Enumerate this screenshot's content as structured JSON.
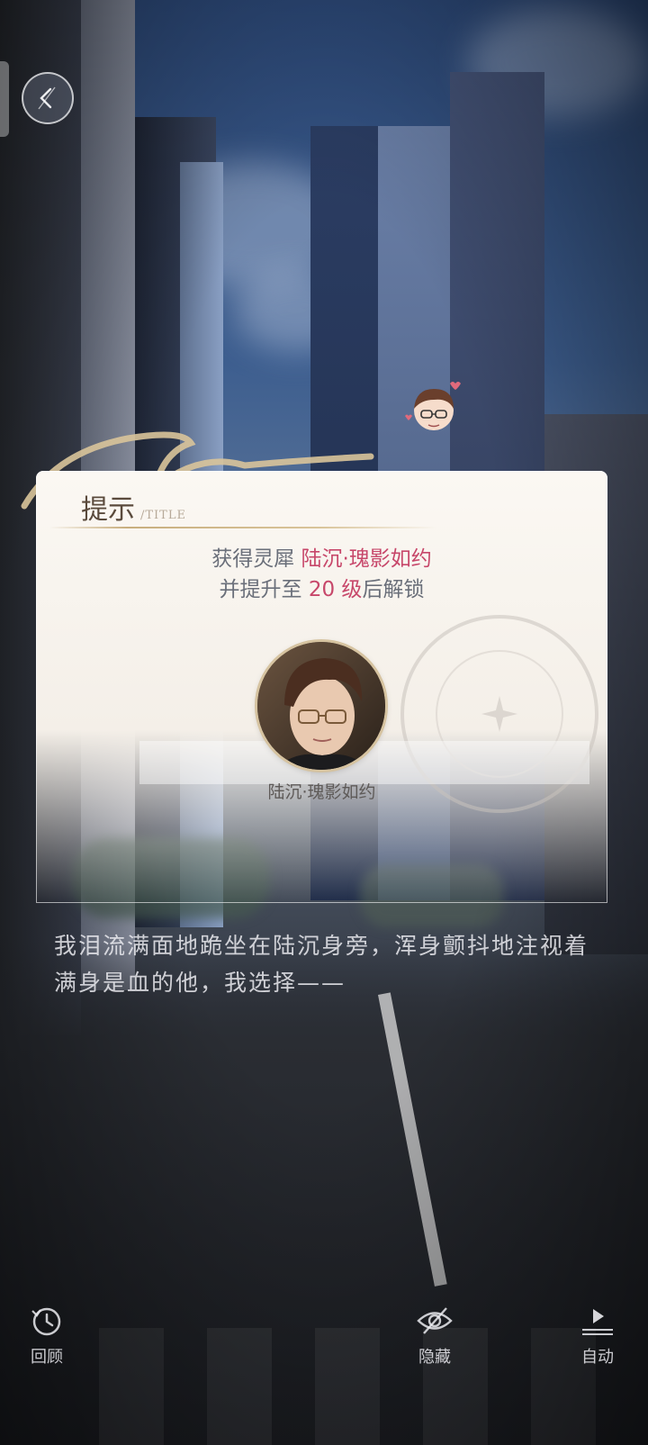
{
  "hint_card": {
    "title": "提示",
    "title_en": "/TITLE",
    "line1_prefix": "获得灵犀 ",
    "line1_highlight": "陆沉·瑰影如约",
    "line2_prefix": "并提升至 ",
    "line2_level": "20 级",
    "line2_suffix": "后解锁",
    "portrait_name": "陆沉·瑰影如约"
  },
  "dialogue": {
    "text": "我泪流满面地跪坐在陆沉身旁，浑身颤抖地注视着满身是血的他，我选择——"
  },
  "controls": {
    "review": "回顾",
    "hide": "隐藏",
    "auto": "自动"
  },
  "colors": {
    "accent_pink": "#c7476a",
    "card_bg": "#fbf8f3",
    "gold": "#d9c49a"
  },
  "icons": {
    "back": "back-arrow-icon",
    "review": "history-clock-icon",
    "hide": "eye-slash-icon",
    "auto": "play-auto-icon"
  }
}
